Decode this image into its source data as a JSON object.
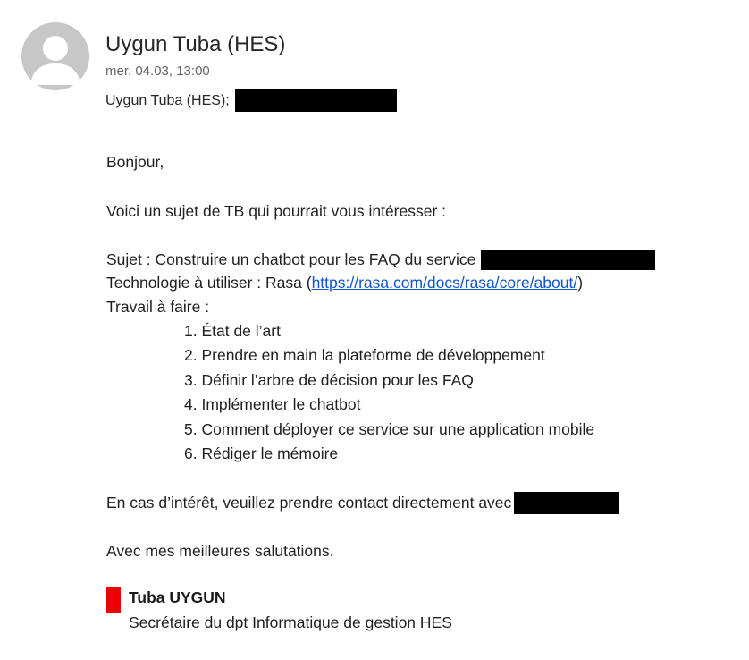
{
  "header": {
    "sender": "Uygun Tuba (HES)",
    "date": "mer. 04.03, 13:00",
    "recipients_prefix": "Uygun Tuba (HES);"
  },
  "avatar": {
    "icon": "person-silhouette-icon",
    "bg_color": "#c7c7c7",
    "fg_color": "#ffffff"
  },
  "body": {
    "greeting": "Bonjour,",
    "intro": "Voici un sujet de TB qui pourrait vous intéresser :",
    "subject": "Sujet : Construire un chatbot pour les FAQ du service",
    "technology_prefix": "Technologie  à utiliser : Rasa (",
    "technology_link": "https://rasa.com/docs/rasa/core/about/",
    "technology_suffix": ")",
    "work_label": "Travail à faire :",
    "tasks": [
      "1. État de l’art",
      "2. Prendre en main la plateforme de développement",
      "3. Définir l’arbre de décision pour les FAQ",
      "4. Implémenter le chatbot",
      "5. Comment déployer ce service sur une application mobile",
      "6. Rédiger le mémoire"
    ],
    "contact": "En cas d’intérêt, veuillez prendre contact directement avec",
    "closing": "Avec mes meilleures salutations."
  },
  "signature": {
    "name": "Tuba UYGUN",
    "title": "Secrétaire du dpt Informatique de gestion HES",
    "bar_color": "#ee0000"
  },
  "colors": {
    "link": "#1155cc",
    "redaction": "#000000"
  }
}
